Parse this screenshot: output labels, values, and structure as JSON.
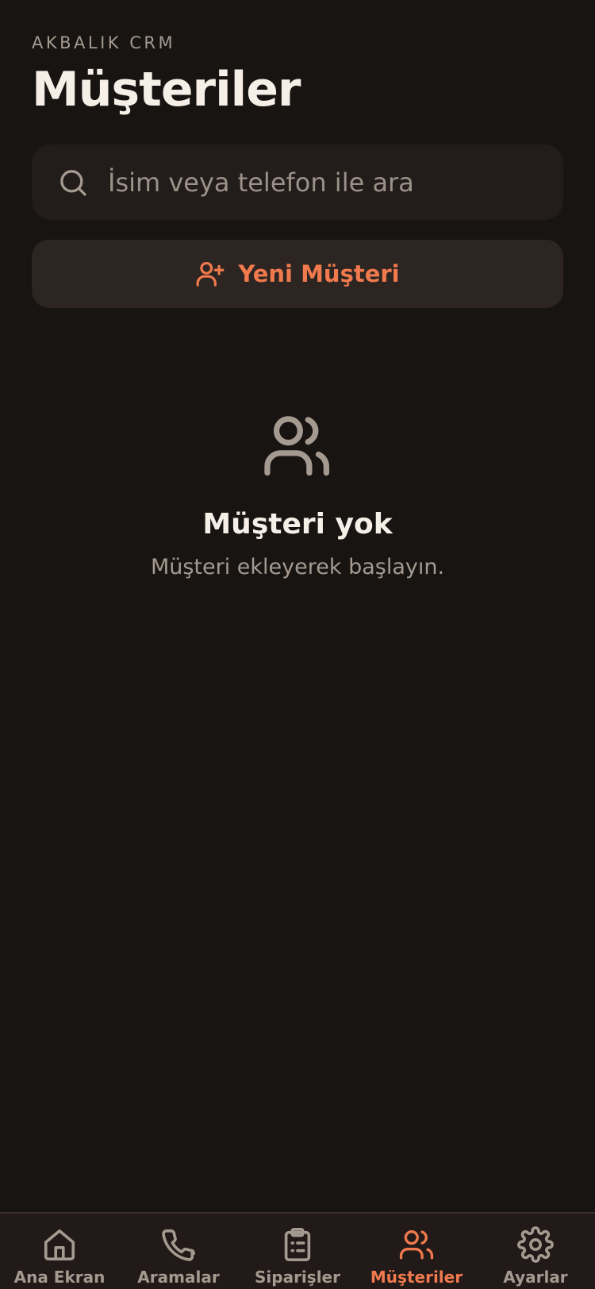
{
  "header": {
    "eyebrow": "AKBALIK CRM",
    "title": "Müşteriler"
  },
  "search": {
    "placeholder": "İsim veya telefon ile ara",
    "value": "",
    "icon": "search-icon"
  },
  "new_customer_button": {
    "label": "Yeni Müşteri",
    "icon": "user-plus-icon"
  },
  "empty_state": {
    "icon": "users-icon",
    "title": "Müşteri yok",
    "subtitle": "Müşteri ekleyerek başlayın."
  },
  "tabs": [
    {
      "label": "Ana Ekran",
      "icon": "home-icon",
      "active": false
    },
    {
      "label": "Aramalar",
      "icon": "phone-icon",
      "active": false
    },
    {
      "label": "Siparişler",
      "icon": "clipboard-list-icon",
      "active": false
    },
    {
      "label": "Müşteriler",
      "icon": "users-icon",
      "active": true
    },
    {
      "label": "Ayarlar",
      "icon": "gear-icon",
      "active": false
    }
  ],
  "colors": {
    "background": "#181412",
    "surface": "#221d1a",
    "button_surface": "#2d2521",
    "accent": "#f07a4e",
    "muted": "#a59a90",
    "text": "#f6efe8"
  }
}
